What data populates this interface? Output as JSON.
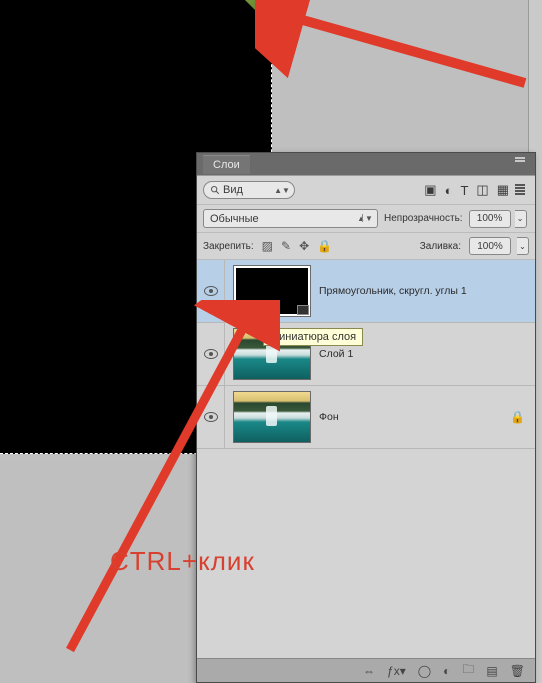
{
  "panel": {
    "tab": "Слои",
    "filter_label": "Вид",
    "blend_mode": "Обычные",
    "opacity_label": "Непрозрачность:",
    "opacity_value": "100%",
    "lock_label": "Закрепить:",
    "fill_label": "Заливка:",
    "fill_value": "100%"
  },
  "layers": [
    {
      "name": "Прямоугольник, скругл. углы 1",
      "visible": true,
      "selected": true,
      "kind": "shape",
      "locked": false
    },
    {
      "name": "Слой 1",
      "visible": true,
      "selected": false,
      "kind": "image",
      "locked": false
    },
    {
      "name": "Фон",
      "visible": true,
      "selected": false,
      "kind": "image",
      "locked": true
    }
  ],
  "tooltip": "Миниатюра слоя",
  "annotation": "CTRL+клик"
}
